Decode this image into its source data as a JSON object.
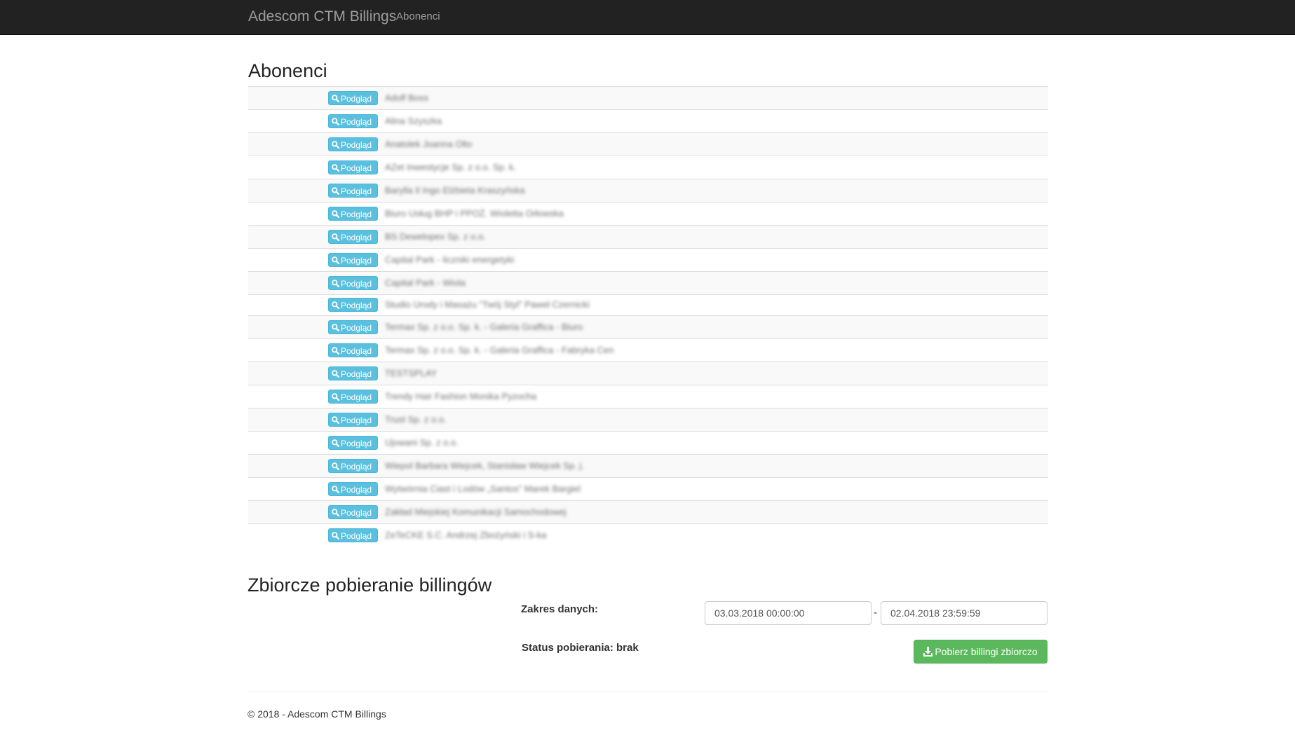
{
  "navbar": {
    "brand": "Adescom CTM Billings",
    "links": [
      "Abonenci"
    ]
  },
  "abonenci": {
    "title": "Abonenci",
    "button_label": "Podgląd",
    "button_icon": "search-icon",
    "rows": [
      {
        "name": "Adolf Boss"
      },
      {
        "name": "Alina Szyszka"
      },
      {
        "name": "Anatolek Joanna Olto"
      },
      {
        "name": "AZet Inwestycje Sp. z o.o. Sp. k."
      },
      {
        "name": "Barylla Il Ingo Elżbieta Kraszyńska"
      },
      {
        "name": "Biuro Usług BHP i PPOŻ. Wioletta Orłowska"
      },
      {
        "name": "BS Dewelopex Sp. z o.o."
      },
      {
        "name": "Capital Park - liczniki energetyki"
      },
      {
        "name": "Capital Park - Wiola"
      },
      {
        "name": "Studio Urody i Masażu \"Twój Styl\" Paweł Czernicki"
      },
      {
        "name": "Termax Sp. z o.o. Sp. k. - Galeria Graffica - Biuro"
      },
      {
        "name": "Termax Sp. z o.o. Sp. k. - Galeria Graffica - Fabryka Cen"
      },
      {
        "name": "TESTSPLAY"
      },
      {
        "name": "Trendy Hair Fashion Monika Pyzocha"
      },
      {
        "name": "Trust Sp. z o.o."
      },
      {
        "name": "Ujowani Sp. z o.o."
      },
      {
        "name": "Wiepol Barbara Wiejcek, Stanisław Wiejcek Sp. j."
      },
      {
        "name": "Wytwórnia Ciast i Lodów „Santos\" Marek Bargiel"
      },
      {
        "name": "Zakład Miejskiej Komunikacji Samochodowej"
      },
      {
        "name": "ZeTeCKE S.C. Andrzej Zbożyński i S-ka"
      }
    ]
  },
  "zbiorcze": {
    "title": "Zbiorcze pobieranie billingów",
    "range_label": "Zakres danych:",
    "date_from": "03.03.2018 00:00:00",
    "separator": "-",
    "date_to": "02.04.2018 23:59:59",
    "status_label": "Status pobierania: brak",
    "download_button": "Pobierz billingi zbiorczo",
    "download_icon": "download-icon"
  },
  "footer": {
    "text": "© 2018 - Adescom CTM Billings"
  },
  "colors": {
    "navbar_bg": "#222222",
    "info_button": "#5bc0de",
    "success_button": "#5cb85c"
  }
}
